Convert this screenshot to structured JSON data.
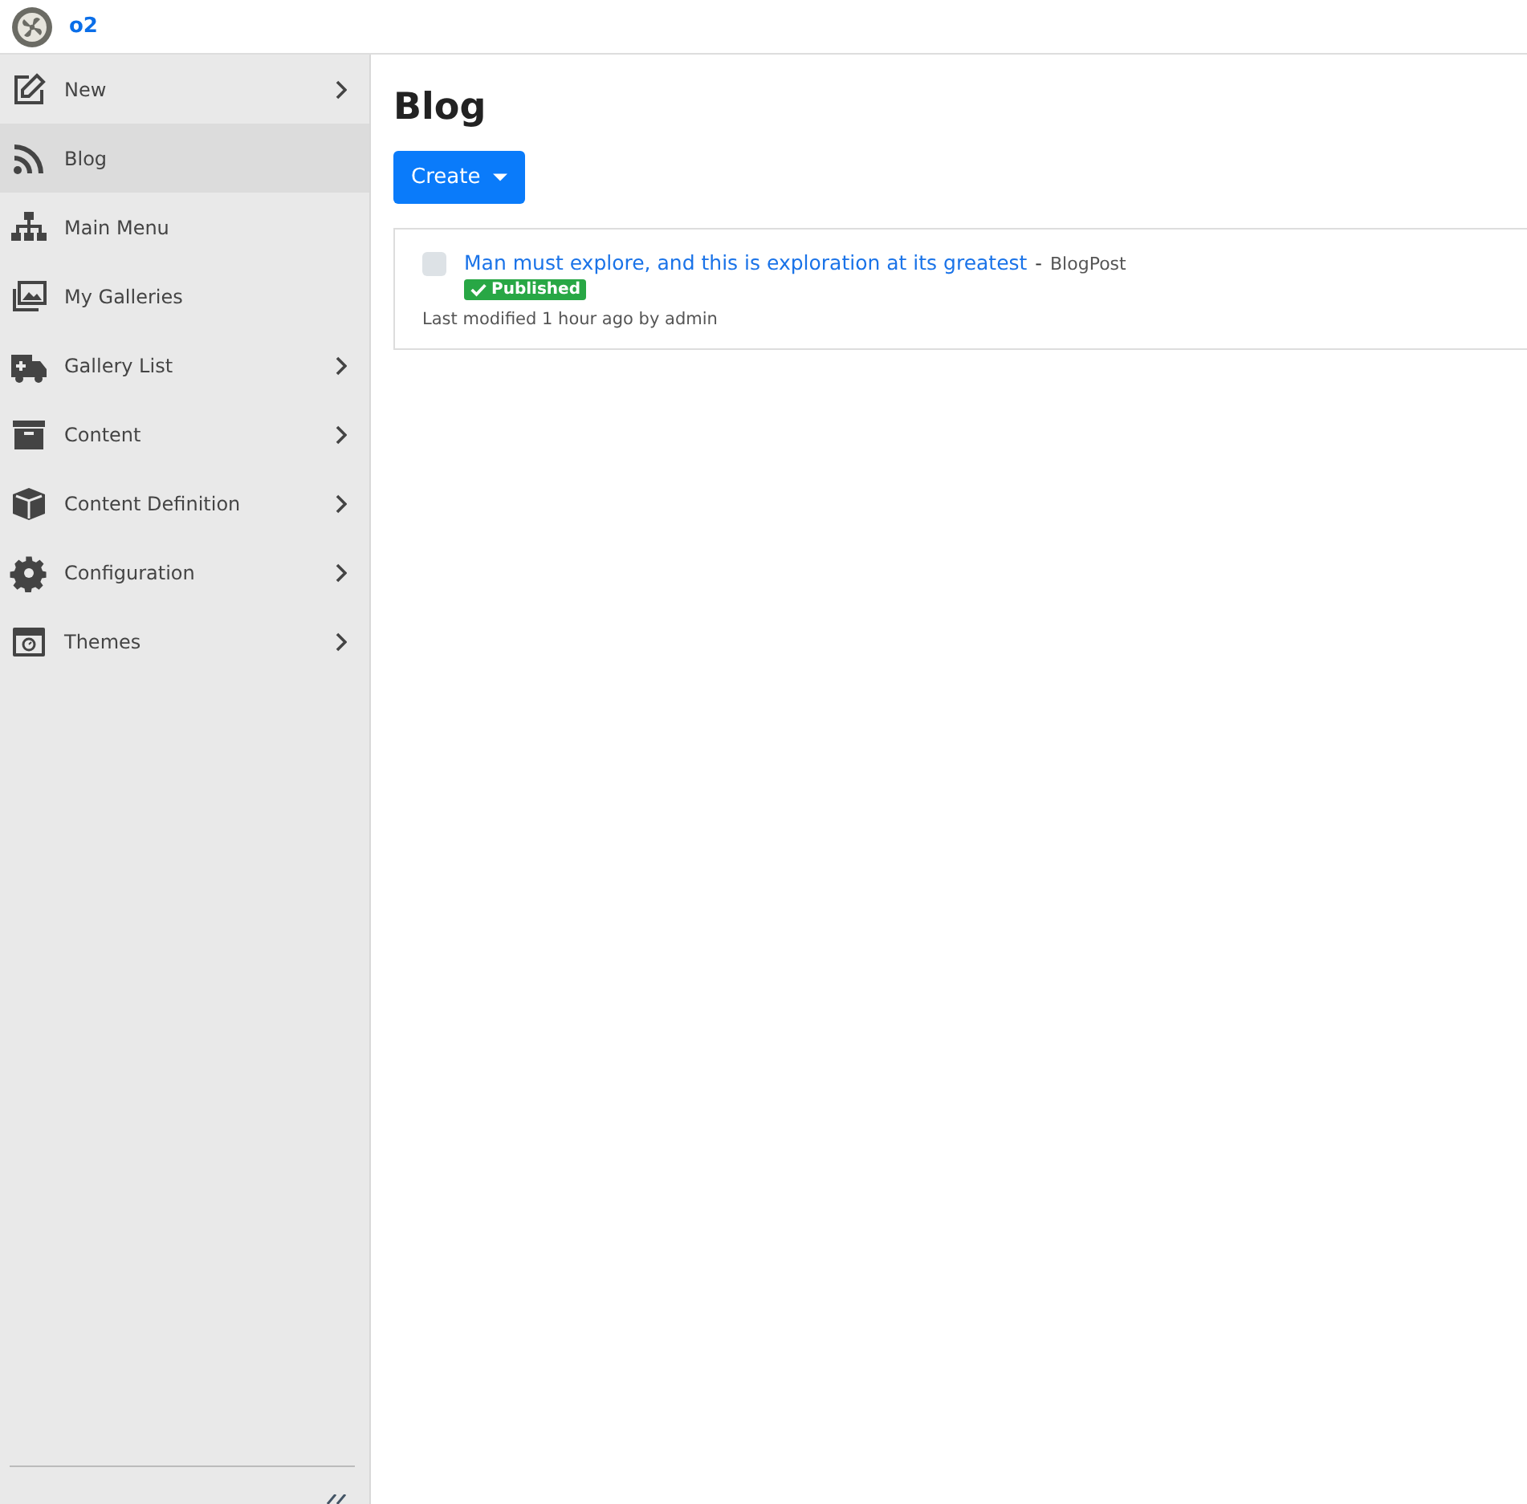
{
  "brand": {
    "name": "o2"
  },
  "sidebar": {
    "items": [
      {
        "label": "New",
        "selected": false,
        "expandable": true
      },
      {
        "label": "Blog",
        "selected": true,
        "expandable": false
      },
      {
        "label": "Main Menu",
        "selected": false,
        "expandable": false
      },
      {
        "label": "My Galleries",
        "selected": false,
        "expandable": false
      },
      {
        "label": "Gallery List",
        "selected": false,
        "expandable": true
      },
      {
        "label": "Content",
        "selected": false,
        "expandable": true
      },
      {
        "label": "Content Definition",
        "selected": false,
        "expandable": true
      },
      {
        "label": "Configuration",
        "selected": false,
        "expandable": true
      },
      {
        "label": "Themes",
        "selected": false,
        "expandable": true
      }
    ]
  },
  "page": {
    "title": "Blog",
    "create_button": "Create",
    "items": [
      {
        "checked": false,
        "title": "Man must explore, and this is exploration at its greatest",
        "separator": "-",
        "type": "BlogPost",
        "status": "Published",
        "meta": "Last modified 1 hour ago by admin"
      }
    ]
  }
}
